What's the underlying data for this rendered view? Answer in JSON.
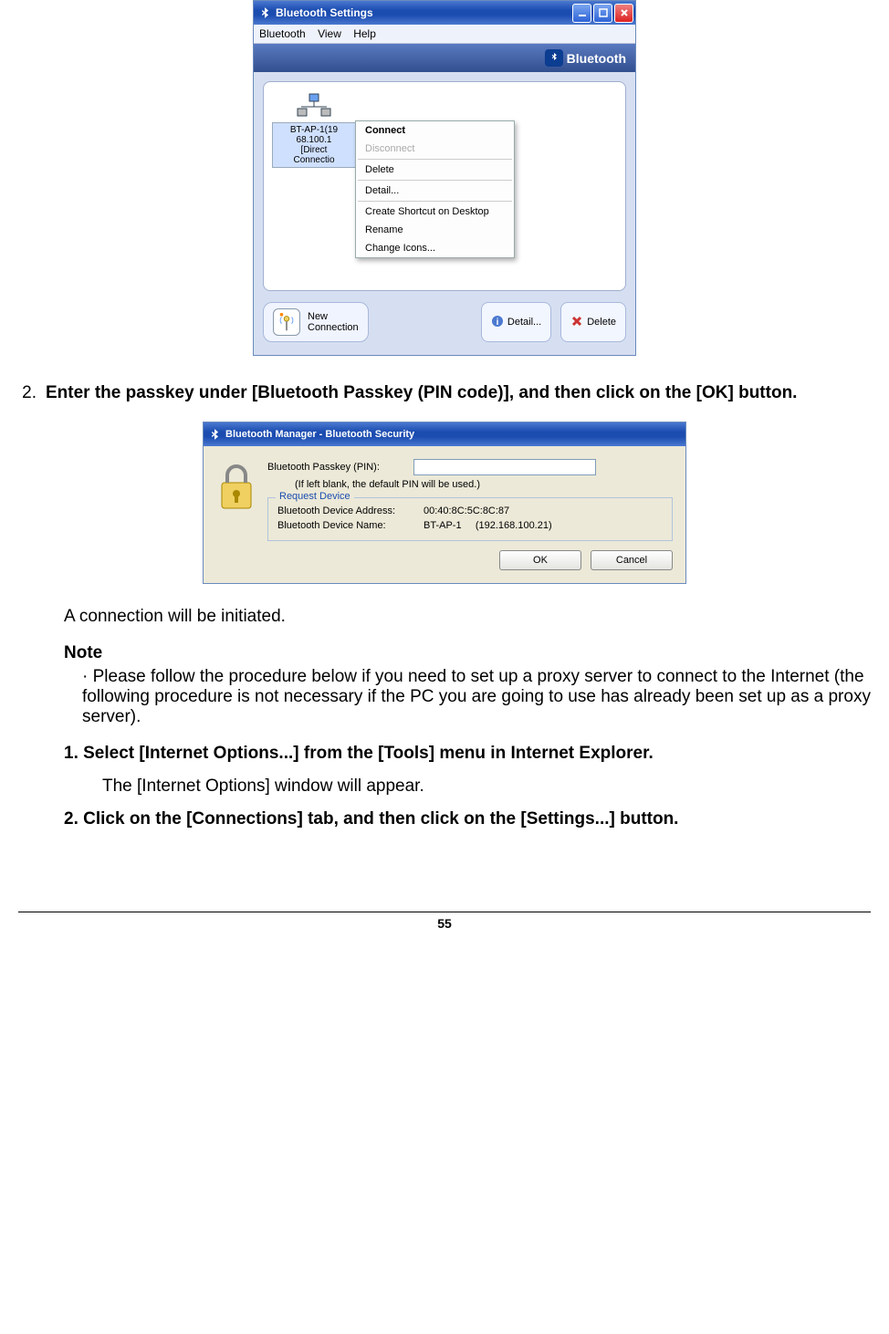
{
  "screenshot1": {
    "title": "Bluetooth Settings",
    "menubar": [
      "Bluetooth",
      "View",
      "Help"
    ],
    "brand": "Bluetooth",
    "device": {
      "line1": "BT-AP-1(19",
      "line2": "68.100.1",
      "line3": "[Direct",
      "line4": "Connectio"
    },
    "context_menu": [
      {
        "label": "Connect",
        "bold": true
      },
      {
        "label": "Disconnect",
        "disabled": true
      },
      {
        "sep": true
      },
      {
        "label": "Delete"
      },
      {
        "sep": true
      },
      {
        "label": "Detail..."
      },
      {
        "sep": true
      },
      {
        "label": "Create Shortcut on Desktop"
      },
      {
        "label": "Rename"
      },
      {
        "label": "Change Icons..."
      }
    ],
    "newconn": {
      "line1": "New",
      "line2": "Connection"
    },
    "btn_detail": "Detail...",
    "btn_delete": "Delete"
  },
  "step2": {
    "num": "2.",
    "text": "Enter the passkey under [Bluetooth Passkey (PIN code)], and then click on the [OK] button."
  },
  "screenshot2": {
    "title": "Bluetooth Manager - Bluetooth Security",
    "passkey_label": "Bluetooth Passkey (PIN):",
    "hint": "(If left blank, the default PIN will be used.)",
    "fieldset_legend": "Request Device",
    "addr_label": "Bluetooth Device Address:",
    "addr_value": "00:40:8C:5C:8C:87",
    "name_label": "Bluetooth Device Name:",
    "name_value": "BT-AP-1     (192.168.100.21)",
    "ok": "OK",
    "cancel": "Cancel"
  },
  "after": "A connection will be initiated.",
  "note_h": "Note",
  "note_b": "· Please follow the procedure below if you need to set up a proxy server to connect to the Internet (the following procedure is not necessary if the PC you are going to use has already been set up as a proxy server).",
  "sub1": "1. Select [Internet Options...] from the [Tools] menu in Internet Explorer.",
  "sub1_text": "The [Internet Options] window will appear.",
  "sub2": "2. Click on the [Connections] tab, and then click on the [Settings...] button.",
  "page_number": "55"
}
